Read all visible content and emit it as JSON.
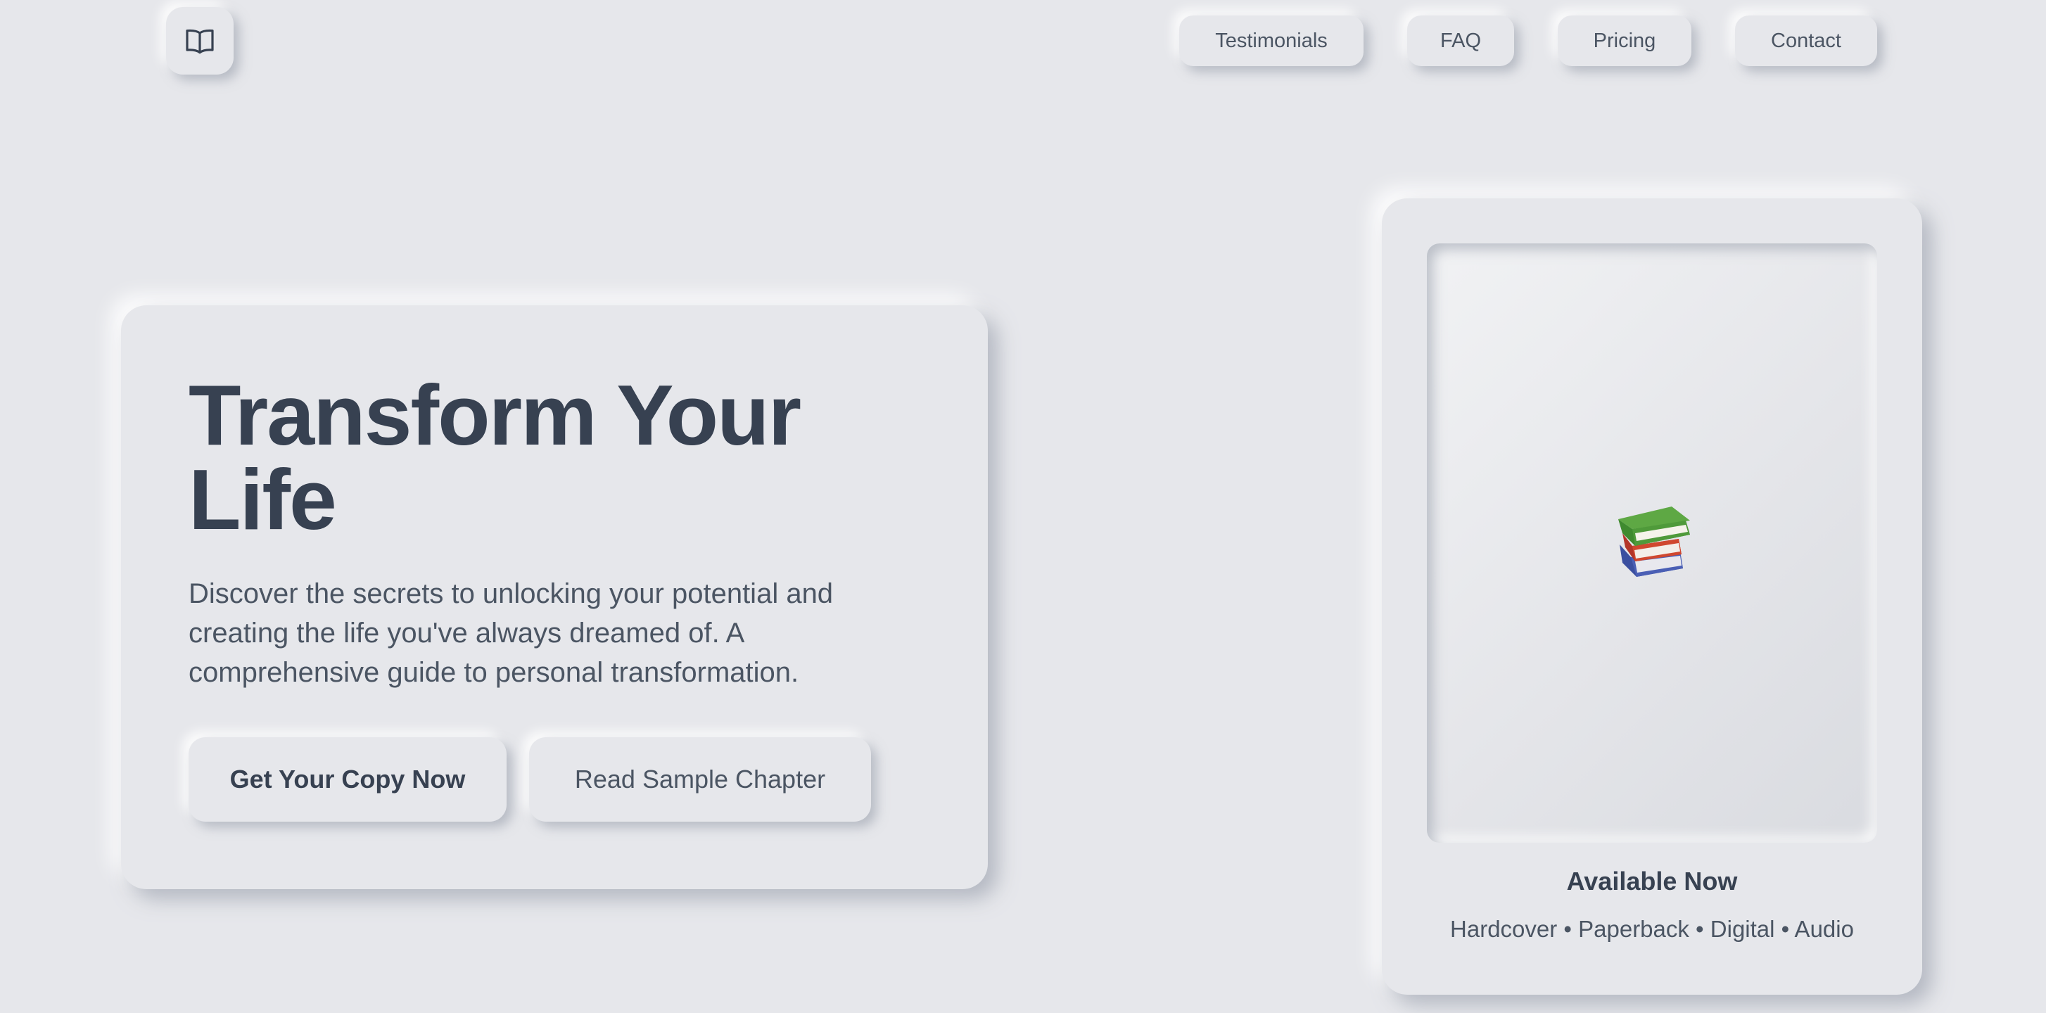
{
  "nav": {
    "logo_icon": "open-book-icon",
    "items": [
      {
        "label": "Testimonials"
      },
      {
        "label": "FAQ"
      },
      {
        "label": "Pricing"
      },
      {
        "label": "Contact"
      }
    ]
  },
  "hero": {
    "title": "Transform Your Life",
    "description": "Discover the secrets to unlocking your potential and creating the life you've always dreamed of. A comprehensive guide to personal transformation.",
    "primary_button": "Get Your Copy Now",
    "secondary_button": "Read Sample Chapter"
  },
  "product": {
    "cover_icon": "books-stack-icon",
    "status": "Available Now",
    "formats": "Hardcover • Paperback • Digital • Audio"
  },
  "colors": {
    "background": "#e6e7eb",
    "text_primary": "#374151",
    "text_secondary": "#4b5563",
    "book_green": "#4f9a3a",
    "book_red": "#c8412b",
    "book_blue": "#3b4fa0"
  }
}
